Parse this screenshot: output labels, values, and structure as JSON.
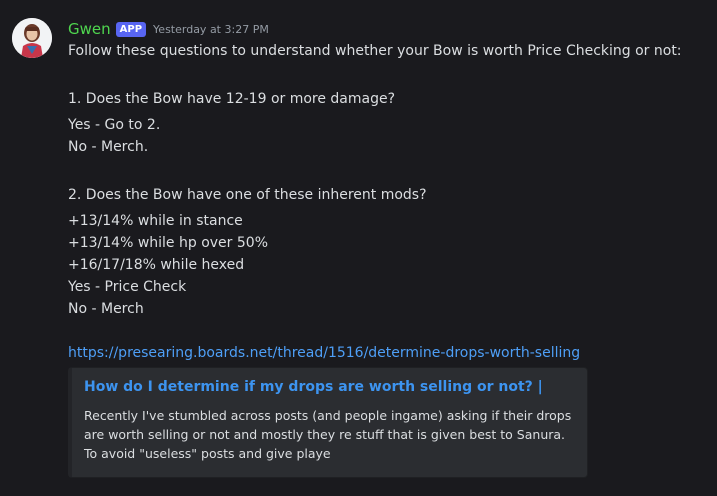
{
  "message": {
    "username": "Gwen",
    "badge": "APP",
    "timestamp": "Yesterday at 3:27 PM",
    "intro": "Follow these questions to understand whether your Bow is worth Price Checking or not:",
    "question1": {
      "title": "1. Does the Bow have 12-19 or more damage?",
      "answers": [
        "Yes - Go to 2.",
        "No - Merch."
      ]
    },
    "question2": {
      "title": "2. Does the Bow have one of these inherent mods?",
      "answers": [
        "+13/14% while in stance",
        "+13/14% while hp over 50%",
        "+16/17/18% while hexed",
        "Yes - Price Check",
        "No - Merch"
      ]
    },
    "link": "https://presearing.boards.net/thread/1516/determine-drops-worth-selling",
    "embed": {
      "title": "How do I determine if my drops are worth selling or not? |",
      "description": "Recently I've stumbled across posts (and people ingame) asking if their drops are worth selling or not and mostly they re stuff that is given best to Sanura. To avoid \"useless\" posts and give playe"
    }
  },
  "colors": {
    "background": "#1a1a1e",
    "username": "#4fd64f",
    "badge": "#5865f2",
    "link": "#4e9ff7",
    "embed_bg": "#2b2d31"
  },
  "icons": {
    "avatar": "user-avatar"
  }
}
